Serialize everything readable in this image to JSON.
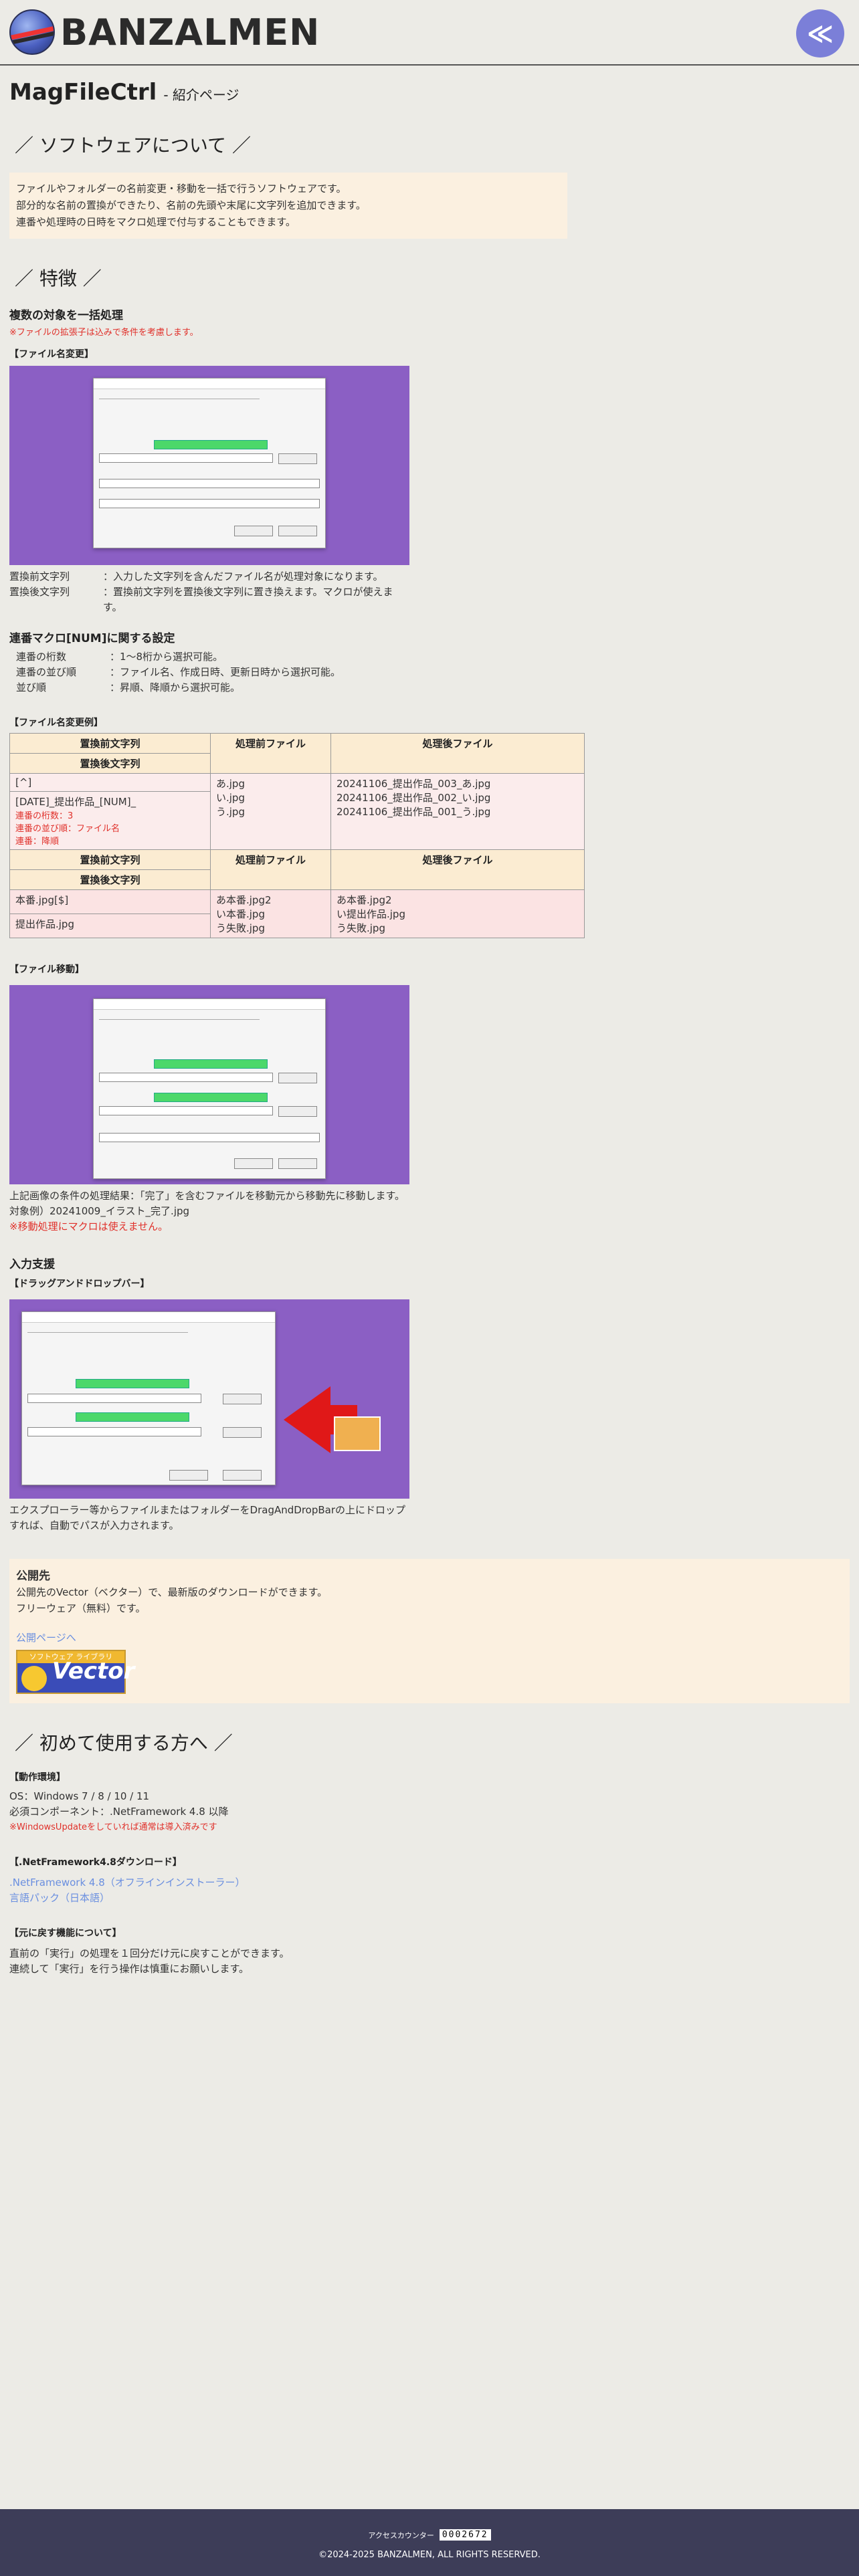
{
  "header": {
    "brand": "BANZALMEN",
    "menu_label": "≪"
  },
  "title": {
    "app": "MagFileCtrl",
    "sub": "- 紹介ページ"
  },
  "about": {
    "heading": "／ ソフトウェアについて ／",
    "lines": [
      "ファイルやフォルダーの名前変更・移動を一括で行うソフトウェアです。",
      "部分的な名前の置換ができたり、名前の先頭や末尾に文字列を追加できます。",
      "連番や処理時の日時をマクロ処理で付与することもできます。"
    ]
  },
  "features": {
    "heading": "／ 特徴 ／",
    "batch_title": "複数の対象を一括処理",
    "batch_note": "※ファイルの拡張子は込みで条件を考慮します。",
    "rename_label": "【ファイル名変更】",
    "rename_desc": [
      {
        "k": "置換前文字列",
        "v": "：入力した文字列を含んだファイル名が処理対象になります。"
      },
      {
        "k": "置換後文字列",
        "v": "：置換前文字列を置換後文字列に置き換えます。マクロが使えます。"
      }
    ],
    "macro_title": "連番マクロ[NUM]に関する設定",
    "macro_desc": [
      {
        "k": "連番の桁数",
        "v": "：1～8桁から選択可能。"
      },
      {
        "k": "連番の並び順",
        "v": "：ファイル名、作成日時、更新日時から選択可能。"
      },
      {
        "k": "並び順",
        "v": "：昇順、降順から選択可能。"
      }
    ],
    "example_label": "【ファイル名変更例】",
    "table": {
      "h_before": "置換前文字列",
      "h_after": "置換後文字列",
      "h_pre": "処理前ファイル",
      "h_post": "処理後ファイル",
      "r1_before": "[^]",
      "r1_after": "[DATE]_提出作品_[NUM]_",
      "r1_n1": "連番の桁数：3",
      "r1_n2": "連番の並び順：ファイル名",
      "r1_n3": "連番：降順",
      "r1_pre": [
        "あ.jpg",
        "い.jpg",
        "う.jpg"
      ],
      "r1_post": [
        "20241106_提出作品_003_あ.jpg",
        "20241106_提出作品_002_い.jpg",
        "20241106_提出作品_001_う.jpg"
      ],
      "r2_before": "本番.jpg[$]",
      "r2_after": "提出作品.jpg",
      "r2_pre": [
        "あ本番.jpg2",
        "い本番.jpg",
        "う失敗.jpg"
      ],
      "r2_post": [
        "あ本番.jpg2",
        "い提出作品.jpg",
        "う失敗.jpg"
      ]
    },
    "move_label": "【ファイル移動】",
    "move_desc": [
      "上記画像の条件の処理結果：「完了」を含むファイルを移動元から移動先に移動します。",
      "対象例）20241009_イラスト_完了.jpg"
    ],
    "move_note": "※移動処理にマクロは使えません。",
    "input_title": "入力支援",
    "dnd_label": "【ドラッグアンドドロップバー】",
    "dnd_desc": "エクスプローラー等からファイルまたはフォルダーをDragAndDropBarの上にドロップすれば、自動でパスが入力されます。"
  },
  "publish": {
    "title": "公開先",
    "lines": [
      "公開先のVector（ベクター）で、最新版のダウンロードができます。",
      "フリーウェア（無料）です。"
    ],
    "link": "公開ページへ",
    "badge_top": "ソフトウェア ライブラリ",
    "badge_text": "Vector"
  },
  "intro": {
    "heading": "／ 初めて使用する方へ ／",
    "env_label": "【動作環境】",
    "os": "OS：Windows 7 / 8 / 10 / 11",
    "req": "必須コンポーネント：.NetFramework 4.8 以降",
    "req_note": "※WindowsUpdateをしていれば通常は導入済みです",
    "dl_label": "【.NetFramework4.8ダウンロード】",
    "dl_link1": ".NetFramework 4.8（オフラインインストーラー）",
    "dl_link2": "言語パック（日本語）",
    "undo_label": "【元に戻す機能について】",
    "undo_lines": [
      "直前の「実行」の処理を１回分だけ元に戻すことができます。",
      "連続して「実行」を行う操作は慎重にお願いします。"
    ]
  },
  "footer": {
    "counter_label": "アクセスカウンター",
    "counter": "0002672",
    "copyright": "©2024-2025 BANZALMEN, ALL RIGHTS RESERVED."
  }
}
